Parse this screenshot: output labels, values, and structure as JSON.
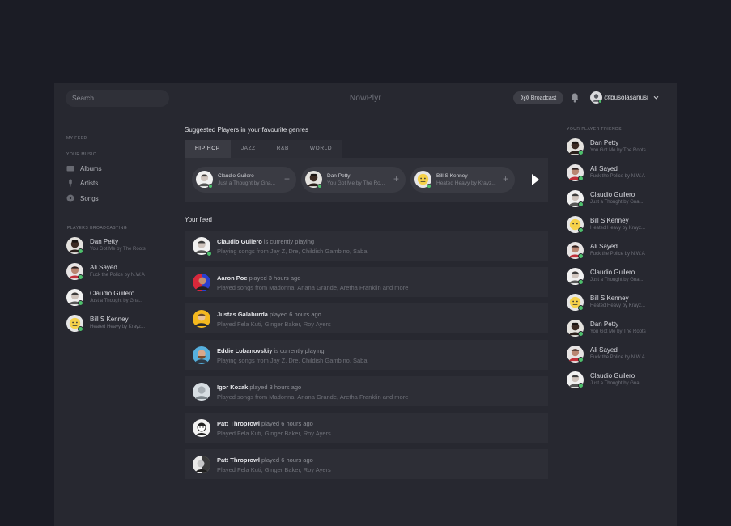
{
  "header": {
    "search_placeholder": "Search",
    "logo": "NowPlyr",
    "broadcast_label": "Broadcast",
    "username": "@busolasanusi"
  },
  "sidebar": {
    "my_feed": "MY FEED",
    "your_music": "YOUR MUSIC",
    "music_items": [
      {
        "label": "Albums",
        "icon": "album-icon"
      },
      {
        "label": "Artists",
        "icon": "microphone-icon"
      },
      {
        "label": "Songs",
        "icon": "disc-icon"
      }
    ],
    "players_broadcasting": "PLAYERS BROADCASTING",
    "broadcasting": [
      {
        "name": "Dan Petty",
        "song": "You Got Me by The Roots"
      },
      {
        "name": "Ali Sayed",
        "song": "Fuck the Police by N.W.A"
      },
      {
        "name": "Claudio Guilero",
        "song": "Just a Thought by Gna..."
      },
      {
        "name": "Bill S Kenney",
        "song": "Heated Heavy by Krayz..."
      }
    ]
  },
  "main": {
    "suggested_title": "Suggested Players in your favourite genres",
    "tabs": [
      "HIP HOP",
      "JAZZ",
      "R&B",
      "WORLD"
    ],
    "active_tab": "HIP HOP",
    "suggested": [
      {
        "name": "Claudio Guilero",
        "song": "Just a Thought by Gna..."
      },
      {
        "name": "Dan Petty",
        "song": "You Got Me by The Ro..."
      },
      {
        "name": "Bill S Kenney",
        "song": "Heated Heavy by Krayz..."
      }
    ],
    "feed_title": "Your feed",
    "feed": [
      {
        "name": "Claudio Guilero",
        "action": " is currently playing",
        "detail": "Playing songs from Jay Z, Dre, Childish Gambino, Saba",
        "online": true
      },
      {
        "name": "Aaron Poe",
        "action": " played 3 hours ago",
        "detail": "Played songs from Madonna, Ariana Grande, Aretha Franklin and more",
        "online": false
      },
      {
        "name": "Justas Galaburda",
        "action": " played 6 hours ago",
        "detail": "Played Fela Kuti, Ginger Baker, Roy Ayers",
        "online": false
      },
      {
        "name": "Eddie Lobanovskiy",
        "action": " is currently playing",
        "detail": "Playing songs from Jay Z, Dre, Childish Gambino, Saba",
        "online": false
      },
      {
        "name": "Igor Kozak",
        "action": " played 3 hours ago",
        "detail": "Played songs from Madonna, Ariana Grande, Aretha Franklin and more",
        "online": false
      },
      {
        "name": "Patt Throprowl",
        "action": " played 6 hours ago",
        "detail": "Played Fela Kuti, Ginger Baker, Roy Ayers",
        "online": false
      },
      {
        "name": "Patt Throprowl",
        "action": " played 6 hours ago",
        "detail": "Played Fela Kuti, Ginger Baker, Roy Ayers",
        "online": false
      }
    ]
  },
  "friends": {
    "title": "YOUR PLAYER FRIENDS",
    "list": [
      {
        "name": "Dan Petty",
        "song": "You Got Me by The Roots"
      },
      {
        "name": "Ali Sayed",
        "song": "Fuck the Police by N.W.A"
      },
      {
        "name": "Claudio Guilero",
        "song": "Just a Thought by Gna..."
      },
      {
        "name": "Bill S Kenney",
        "song": "Heated Heavy by Krayz..."
      },
      {
        "name": "Ali Sayed",
        "song": "Fuck the Police by N.W.A"
      },
      {
        "name": "Claudio Guilero",
        "song": "Just a Thought by Gna..."
      },
      {
        "name": "Bill S Kenney",
        "song": "Heated Heavy by Krayz..."
      },
      {
        "name": "Dan Petty",
        "song": "You Got Me by The Roots"
      },
      {
        "name": "Ali Sayed",
        "song": "Fuck the Police by N.W.A"
      },
      {
        "name": "Claudio Guilero",
        "song": "Just a Thought by Gna..."
      }
    ]
  },
  "colors": {
    "background": "#1b1c25",
    "panel": "#272830",
    "online": "#4ec06c"
  }
}
